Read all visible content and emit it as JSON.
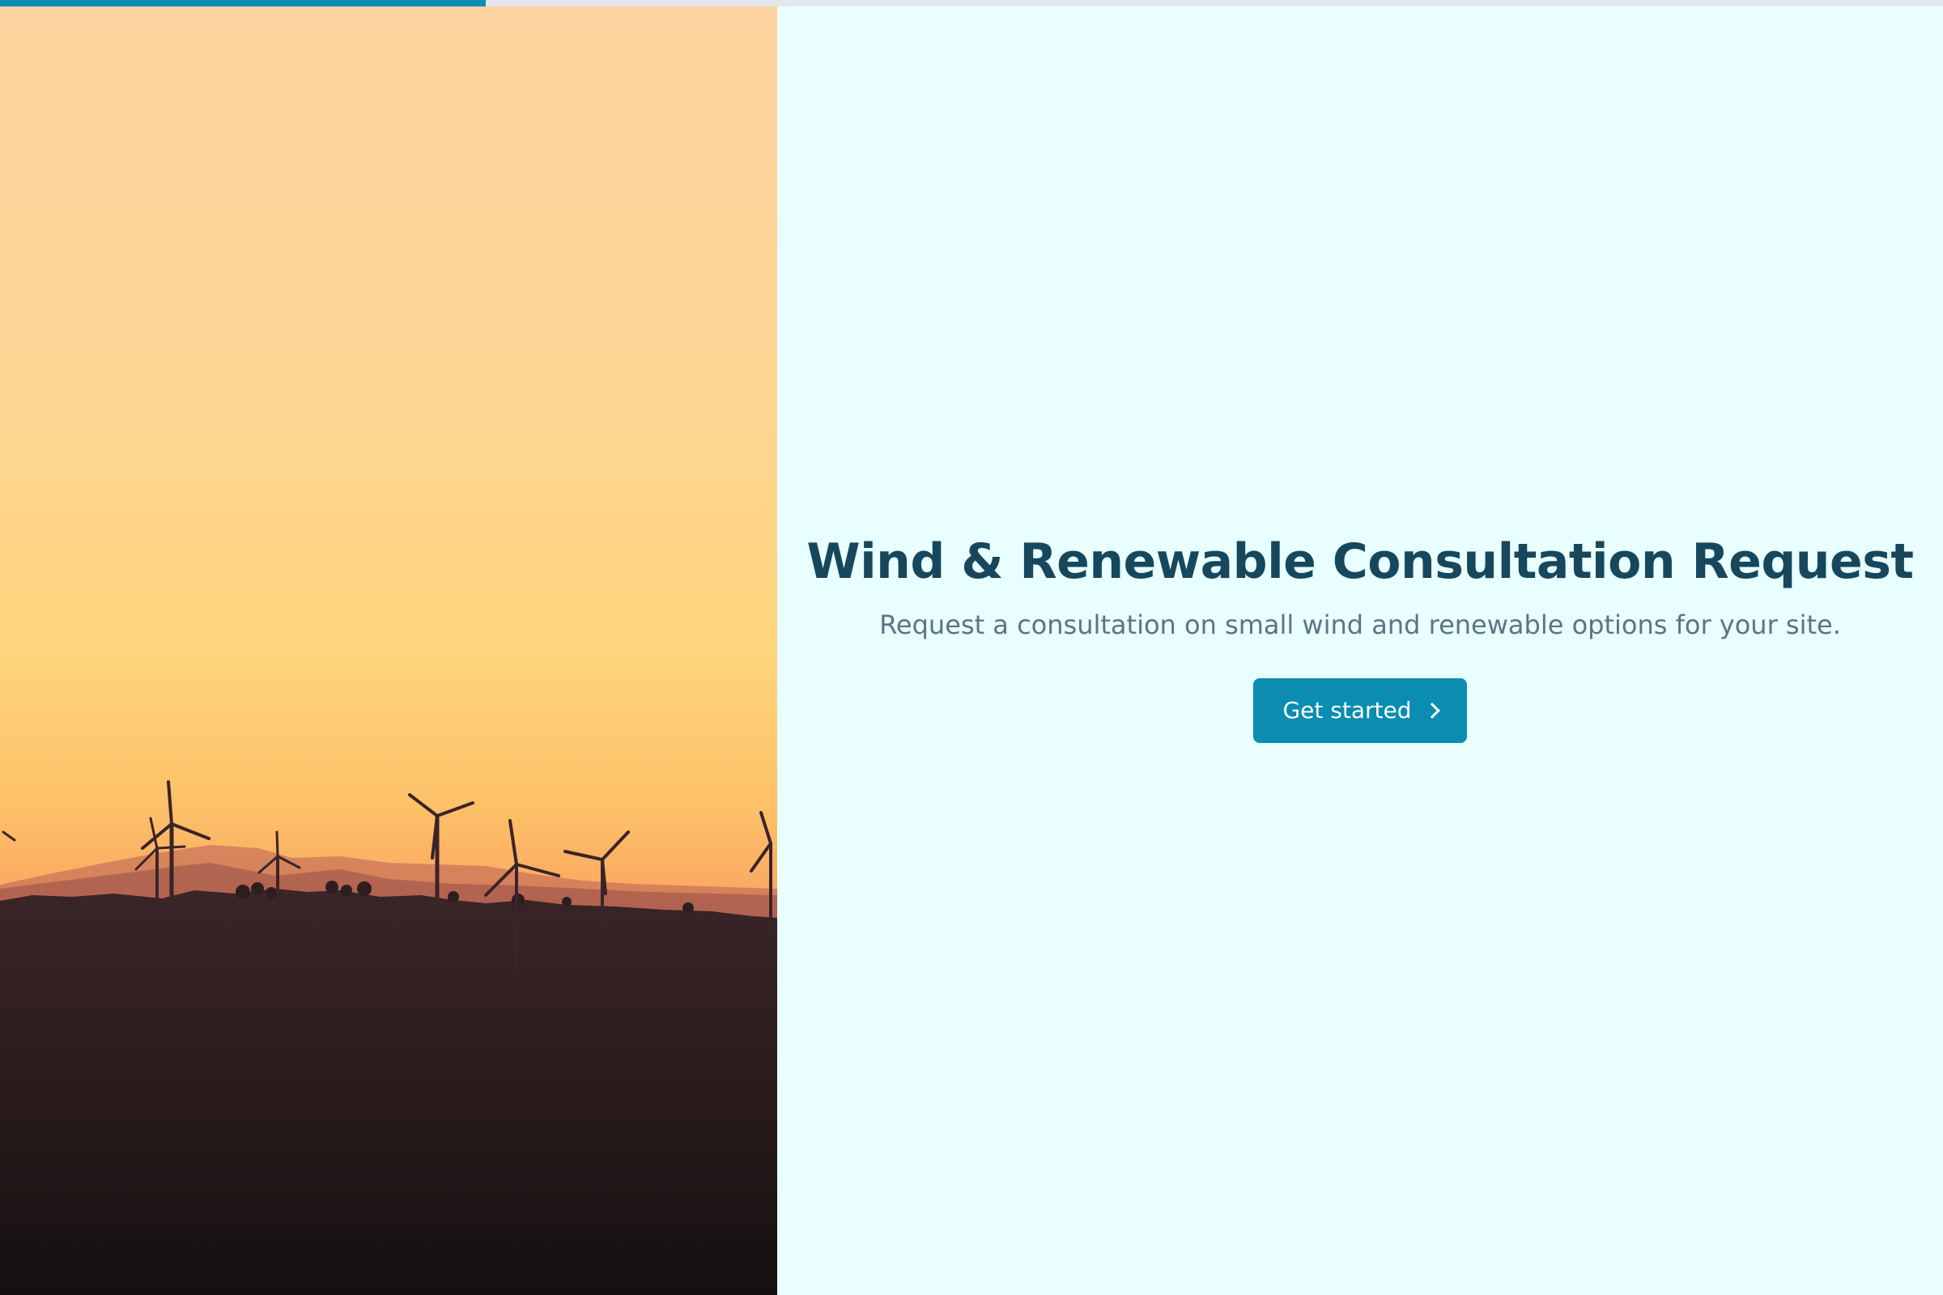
{
  "progress": {
    "value": 0.25,
    "color": "#0a8db0"
  },
  "hero": {
    "image": "wind-turbines-sunset",
    "colors": {
      "sky_top": "#fed6a2",
      "sky_mid": "#fed37b",
      "horizon": "#f99b5b",
      "ground": "#2c1e1e"
    }
  },
  "main": {
    "title": "Wind & Renewable Consultation Request",
    "subtitle": "Request a consultation on small wind and renewable options for your site.",
    "cta_label": "Get started",
    "cta_icon": "chevron-right-icon"
  },
  "colors": {
    "background": "#e9fefe",
    "accent": "#0a8db0",
    "title": "#16475c",
    "subtitle": "#5a7583"
  }
}
